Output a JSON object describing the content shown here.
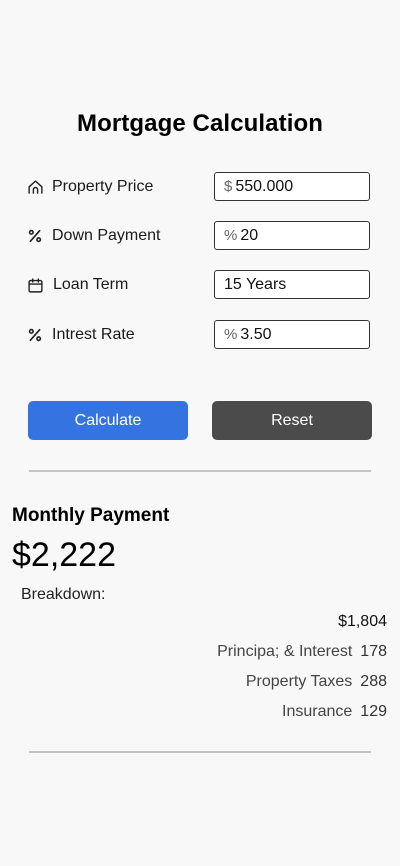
{
  "title": "Mortgage Calculation",
  "fields": [
    {
      "label": "Property Price",
      "prefix": "$",
      "value": "550.000"
    },
    {
      "label": "Down Payment",
      "prefix": "%",
      "value": "20"
    },
    {
      "label": "Loan Term",
      "prefix": "",
      "value": "15 Years"
    },
    {
      "label": "Intrest Rate",
      "prefix": "%",
      "value": "3.50"
    }
  ],
  "buttons": {
    "calculate": "Calculate",
    "reset": "Reset"
  },
  "result": {
    "monthly_label": "Monthly Payment",
    "monthly_value": "$2,222",
    "breakdown_label": "Breakdown:",
    "breakdown_total": "$1,804",
    "items": [
      {
        "label": "Principa; & Interest",
        "value": "178"
      },
      {
        "label": "Property Taxes",
        "value": "288"
      },
      {
        "label": "Insurance",
        "value": "129"
      }
    ]
  },
  "colors": {
    "calculate": "#3574e0",
    "reset": "#4b4b4b"
  },
  "icons": [
    "home-icon",
    "percent-icon",
    "calendar-icon",
    "percent-icon"
  ]
}
